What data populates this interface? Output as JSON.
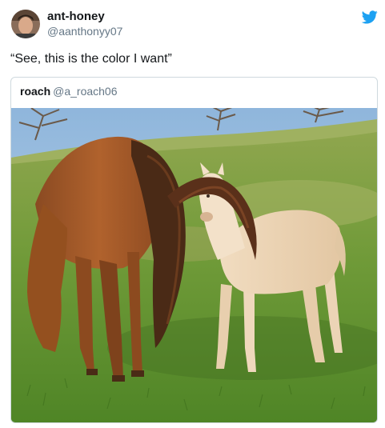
{
  "author": {
    "display_name": "ant-honey",
    "handle": "@aanthonyy07",
    "avatar_icon": "profile-photo"
  },
  "platform_icon": "twitter-bird-icon",
  "tweet_text": "“See, this is the color I want”",
  "quoted_tweet": {
    "display_name": "roach",
    "handle": "@a_roach06",
    "media": "photo-brown-horse-and-pale-foal-in-grass-field"
  },
  "colors": {
    "brand": "#1da1f2",
    "text": "#14171a",
    "secondary_text": "#657786",
    "border": "#cfd9de"
  }
}
